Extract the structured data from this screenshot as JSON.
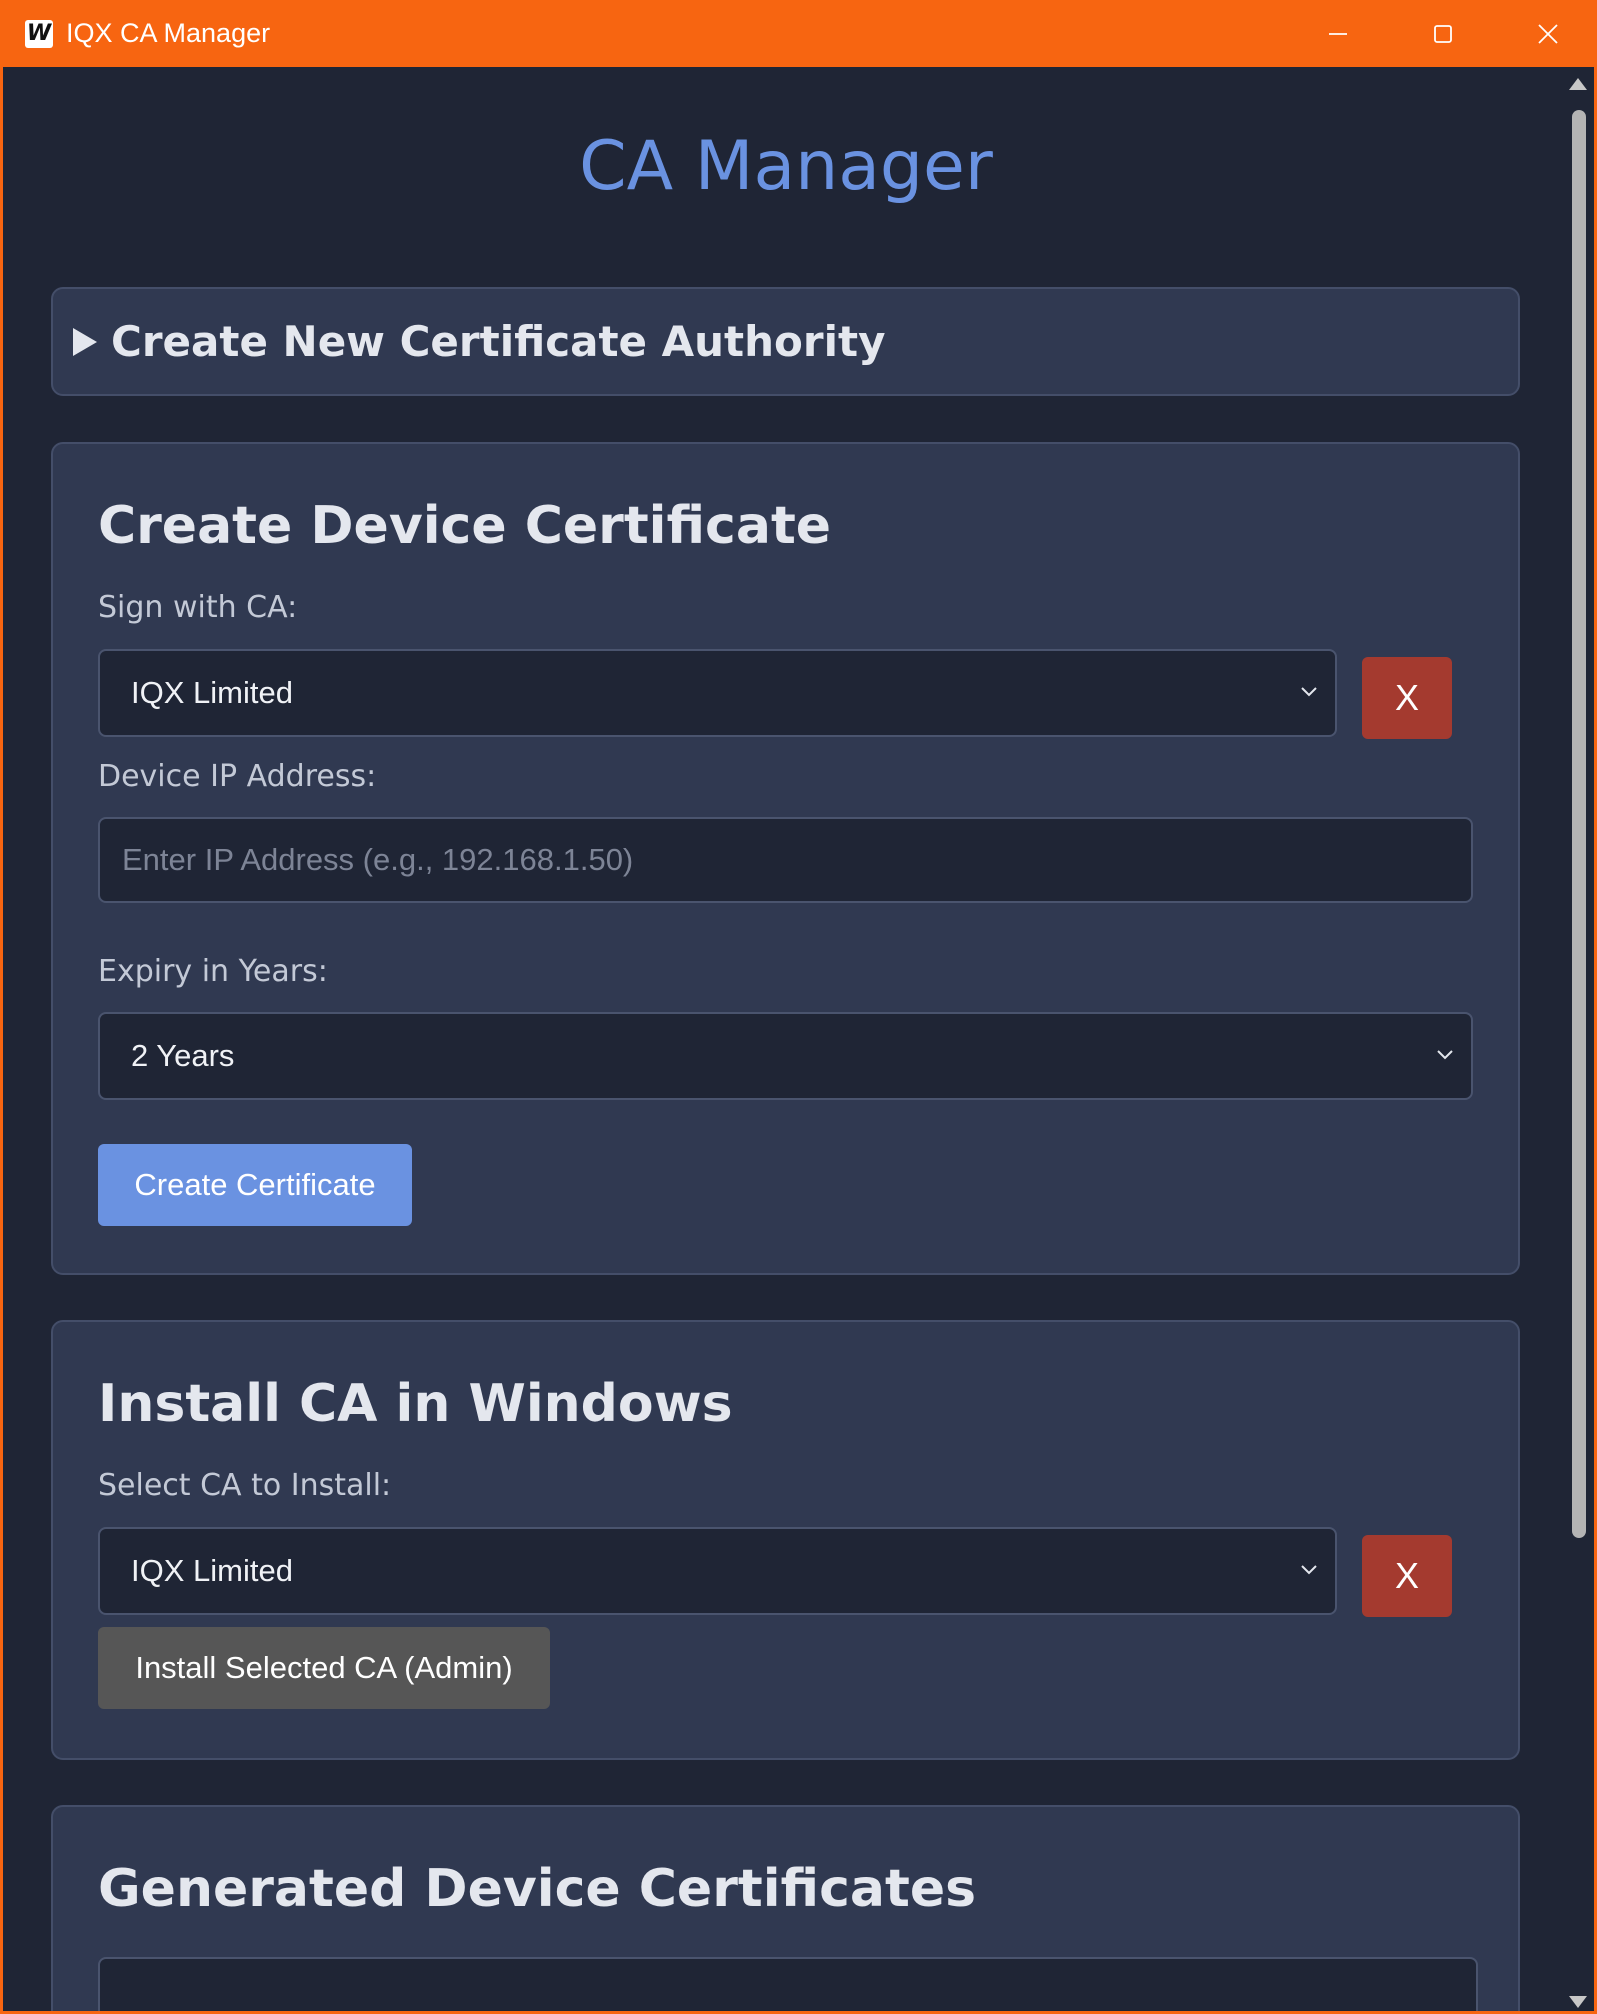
{
  "window": {
    "title": "IQX CA Manager",
    "icon_letter": "W",
    "accent_color": "#f76511",
    "controls": [
      "minimize-icon",
      "maximize-icon",
      "close-icon"
    ]
  },
  "page": {
    "title": "CA Manager",
    "title_color": "#6a92e1"
  },
  "create_ca": {
    "label": "Create New Certificate Authority",
    "expanded": false
  },
  "device_cert": {
    "title": "Create Device Certificate",
    "sign_label": "Sign with CA:",
    "sign_value": "IQX Limited",
    "delete_label": "X",
    "ip_label": "Device IP Address:",
    "ip_value": "",
    "ip_placeholder": "Enter IP Address (e.g., 192.168.1.50)",
    "expiry_label": "Expiry in Years:",
    "expiry_value": "2 Years",
    "create_button": "Create Certificate"
  },
  "install_ca": {
    "title": "Install CA in Windows",
    "select_label": "Select CA to Install:",
    "select_value": "IQX Limited",
    "delete_label": "X",
    "install_button": "Install Selected CA (Admin)"
  },
  "generated": {
    "title": "Generated Device Certificates"
  },
  "colors": {
    "background": "#1f2535",
    "card": "#303951",
    "danger": "#a43a2f",
    "primary": "#6a92e1",
    "secondary": "#565656"
  }
}
